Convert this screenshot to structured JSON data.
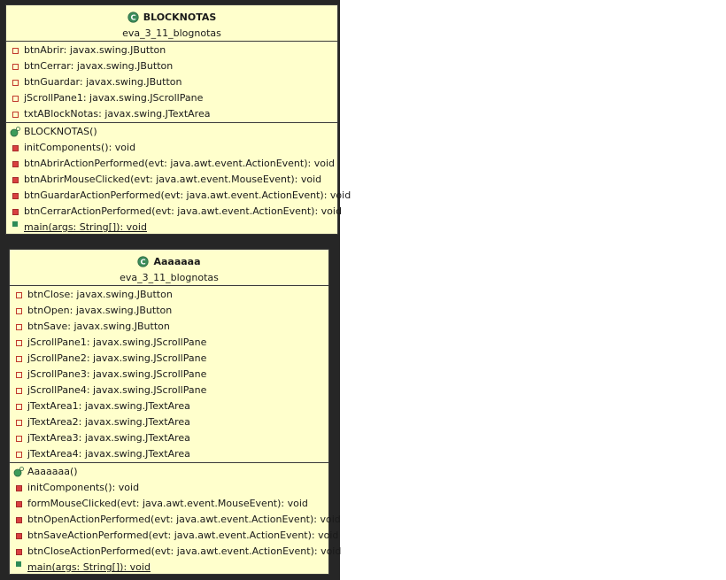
{
  "classes": [
    {
      "name": "BLOCKNOTAS",
      "package": "eva_3_11_blognotas",
      "fields": [
        "btnAbrir: javax.swing.JButton",
        "btnCerrar: javax.swing.JButton",
        "btnGuardar: javax.swing.JButton",
        "jScrollPane1: javax.swing.JScrollPane",
        "txtABlockNotas: javax.swing.JTextArea"
      ],
      "constructor": "BLOCKNOTAS()",
      "methods": [
        "initComponents(): void",
        "btnAbrirActionPerformed(evt: java.awt.event.ActionEvent): void",
        "btnAbrirMouseClicked(evt: java.awt.event.MouseEvent): void",
        "btnGuardarActionPerformed(evt: java.awt.event.ActionEvent): void",
        "btnCerrarActionPerformed(evt: java.awt.event.ActionEvent): void"
      ],
      "static_method": "main(args: String[]): void"
    },
    {
      "name": "Aaaaaaa",
      "package": "eva_3_11_blognotas",
      "fields": [
        "btnClose: javax.swing.JButton",
        "btnOpen: javax.swing.JButton",
        "btnSave: javax.swing.JButton",
        "jScrollPane1: javax.swing.JScrollPane",
        "jScrollPane2: javax.swing.JScrollPane",
        "jScrollPane3: javax.swing.JScrollPane",
        "jScrollPane4: javax.swing.JScrollPane",
        "jTextArea1: javax.swing.JTextArea",
        "jTextArea2: javax.swing.JTextArea",
        "jTextArea3: javax.swing.JTextArea",
        "jTextArea4: javax.swing.JTextArea"
      ],
      "constructor": "Aaaaaaa()",
      "methods": [
        "initComponents(): void",
        "formMouseClicked(evt: java.awt.event.MouseEvent): void",
        "btnOpenActionPerformed(evt: java.awt.event.ActionEvent): void",
        "btnSaveActionPerformed(evt: java.awt.event.ActionEvent): void",
        "btnCloseActionPerformed(evt: java.awt.event.ActionEvent): void"
      ],
      "static_method": "main(args: String[]): void"
    }
  ]
}
